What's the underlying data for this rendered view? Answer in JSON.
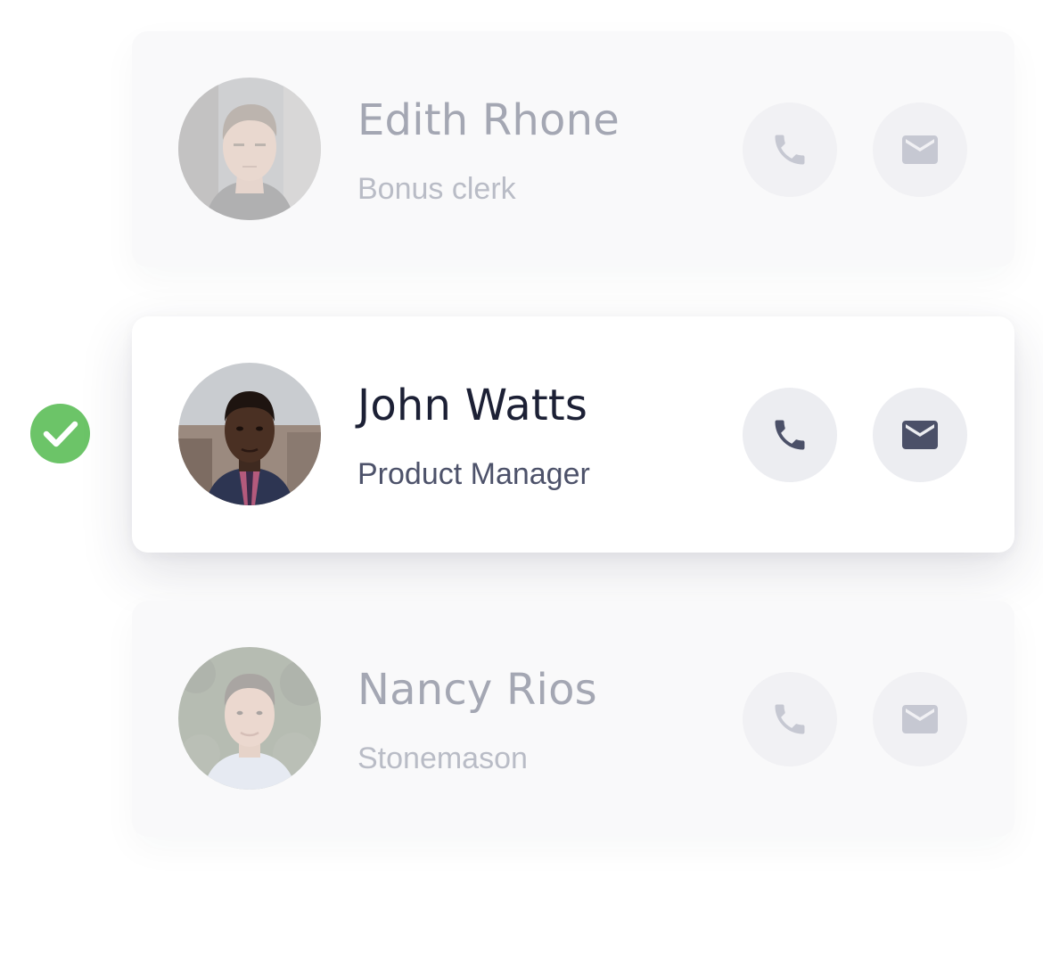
{
  "contacts": [
    {
      "name": "Edith Rhone",
      "role": "Bonus clerk",
      "selected": false,
      "avatar": "man-portrait",
      "actions": [
        "phone-icon",
        "mail-icon"
      ]
    },
    {
      "name": "John Watts",
      "role": "Product Manager",
      "selected": true,
      "avatar": "man-in-suit-portrait",
      "actions": [
        "phone-icon",
        "mail-icon"
      ]
    },
    {
      "name": "Nancy Rios",
      "role": "Stonemason",
      "selected": false,
      "avatar": "young-man-portrait",
      "actions": [
        "phone-icon",
        "mail-icon"
      ]
    }
  ],
  "selection_indicator": {
    "icon": "check-circle-icon",
    "color": "#6cc468"
  },
  "colors": {
    "active_name": "#1c2035",
    "active_role": "#4d526a",
    "dim_name": "#a4a7b3",
    "icon_active": "#4b5068"
  }
}
